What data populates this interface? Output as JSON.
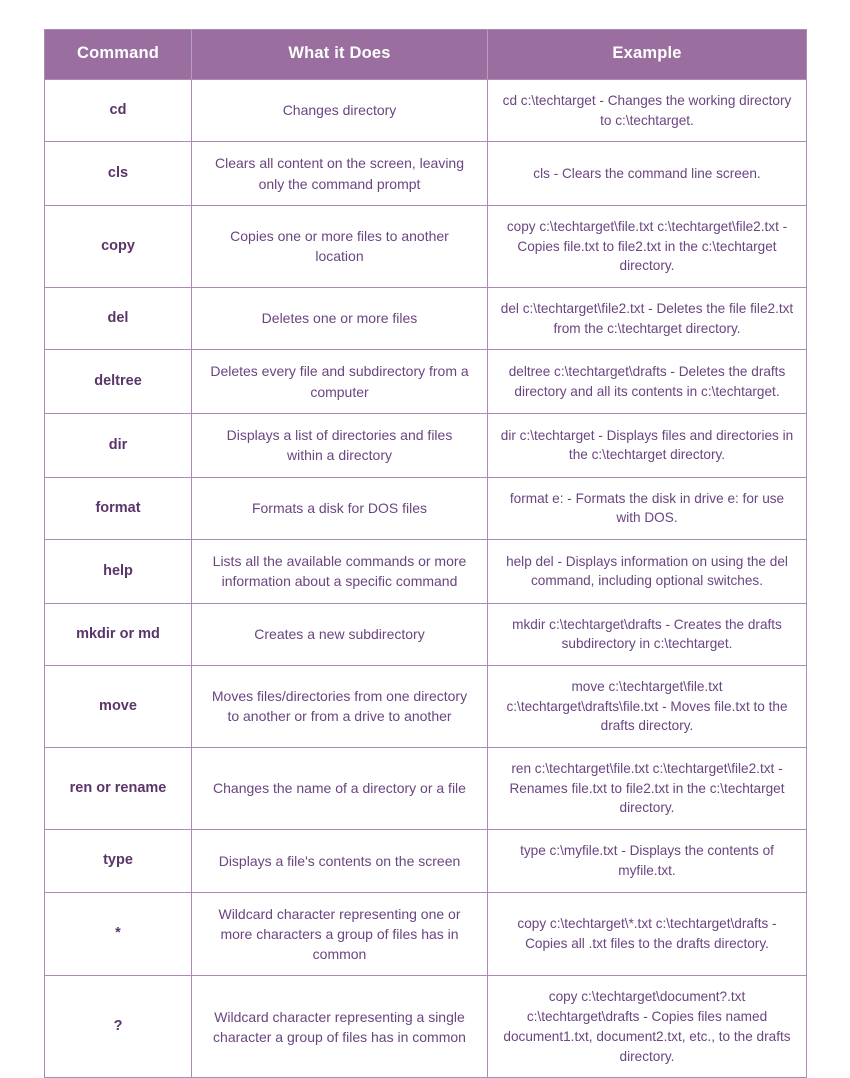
{
  "table": {
    "headers": [
      {
        "label": "Command"
      },
      {
        "label": "What it Does"
      },
      {
        "label": "Example"
      }
    ],
    "colors": {
      "header_background": "#9a6fa0",
      "header_text": "#ffffff",
      "border": "#a98bb5",
      "command_text": "#5b3569",
      "body_text": "#6b4580",
      "page_background": "#ffffff"
    },
    "rows": [
      {
        "command": "cd",
        "description": "Changes directory",
        "example": "cd c:\\techtarget - Changes the working directory to c:\\techtarget."
      },
      {
        "command": "cls",
        "description": "Clears all content on the screen, leaving only the command prompt",
        "example": "cls - Clears the command line screen."
      },
      {
        "command": "copy",
        "description": "Copies one or more files to another location",
        "example": "copy c:\\techtarget\\file.txt c:\\techtarget\\file2.txt - Copies file.txt to file2.txt in the c:\\techtarget directory."
      },
      {
        "command": "del",
        "description": "Deletes one or more files",
        "example": "del c:\\techtarget\\file2.txt - Deletes the file file2.txt from the c:\\techtarget directory."
      },
      {
        "command": "deltree",
        "description": "Deletes every file and subdirectory from a computer",
        "example": "deltree c:\\techtarget\\drafts - Deletes the drafts directory and all its contents in c:\\techtarget."
      },
      {
        "command": "dir",
        "description": "Displays a list of directories and files within a directory",
        "example": "dir c:\\techtarget - Displays files and directories in the c:\\techtarget directory."
      },
      {
        "command": "format",
        "description": "Formats a disk for DOS files",
        "example": "format e: - Formats the disk in drive e: for use with DOS."
      },
      {
        "command": "help",
        "description": "Lists all the available commands or more information about a specific command",
        "example": "help del - Displays information on using the del command, including optional switches."
      },
      {
        "command": "mkdir or md",
        "description": "Creates a new subdirectory",
        "example": "mkdir c:\\techtarget\\drafts - Creates the drafts subdirectory in c:\\techtarget."
      },
      {
        "command": "move",
        "description": "Moves files/directories from one directory to another or from a drive to another",
        "example": "move c:\\techtarget\\file.txt c:\\techtarget\\drafts\\file.txt - Moves file.txt to the drafts directory."
      },
      {
        "command": "ren or rename",
        "description": "Changes the name of a directory or a file",
        "example": "ren c:\\techtarget\\file.txt c:\\techtarget\\file2.txt - Renames file.txt to file2.txt in the c:\\techtarget directory."
      },
      {
        "command": "type",
        "description": "Displays a file's contents on the screen",
        "example": "type c:\\myfile.txt - Displays the contents of myfile.txt."
      },
      {
        "command": "*",
        "description": "Wildcard character representing one or more characters a group of files has in common",
        "example": "copy c:\\techtarget\\*.txt c:\\techtarget\\drafts - Copies all .txt files to the drafts directory."
      },
      {
        "command": "?",
        "description": "Wildcard character representing a single character a group of files has in common",
        "example": "copy c:\\techtarget\\document?.txt c:\\techtarget\\drafts - Copies files named document1.txt, document2.txt, etc., to the drafts directory."
      }
    ]
  }
}
